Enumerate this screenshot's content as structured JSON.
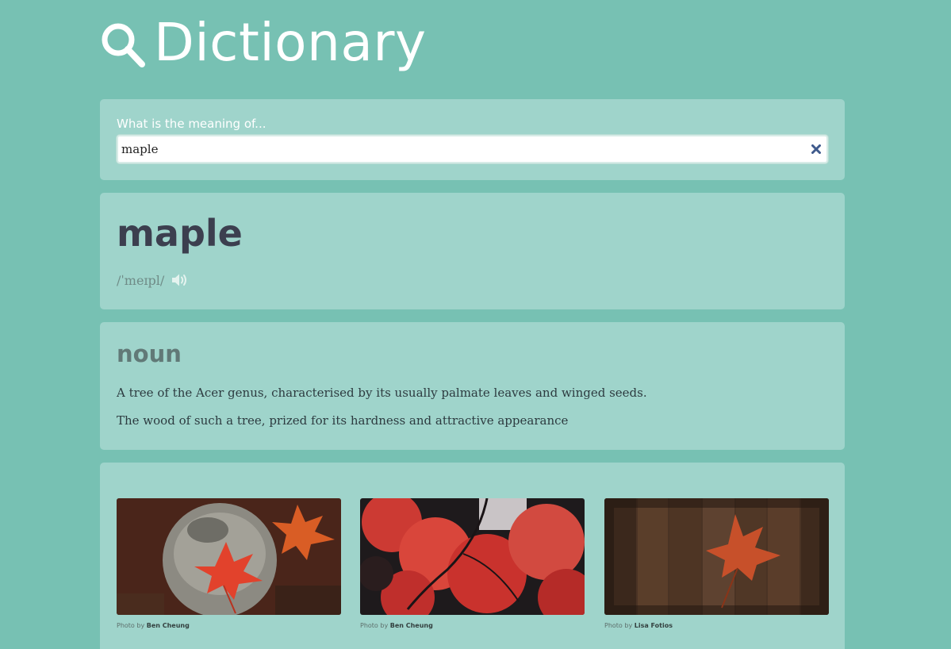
{
  "app": {
    "title": "Dictionary",
    "logo_icon": "magnifier-icon",
    "colors": {
      "background": "#77c1b3",
      "card": "#9fd4cb",
      "text_dark": "#3c3f4f"
    }
  },
  "search": {
    "label": "What is the meaning of...",
    "value": "maple",
    "clear_icon": "close-icon"
  },
  "entry": {
    "word": "maple",
    "phonetic": "/ˈmeɪpl/",
    "audio_icon": "speaker-icon"
  },
  "meaning": {
    "part_of_speech": "noun",
    "definitions": [
      "A tree of the Acer genus, characterised by its usually palmate leaves and winged seeds.",
      "The wood of such a tree, prized for its hardness and attractive appearance"
    ]
  },
  "photos": [
    {
      "prefix": "Photo by",
      "author": "Ben Cheung"
    },
    {
      "prefix": "Photo by",
      "author": "Ben Cheung"
    },
    {
      "prefix": "Photo by",
      "author": "Lisa Fotios"
    }
  ]
}
